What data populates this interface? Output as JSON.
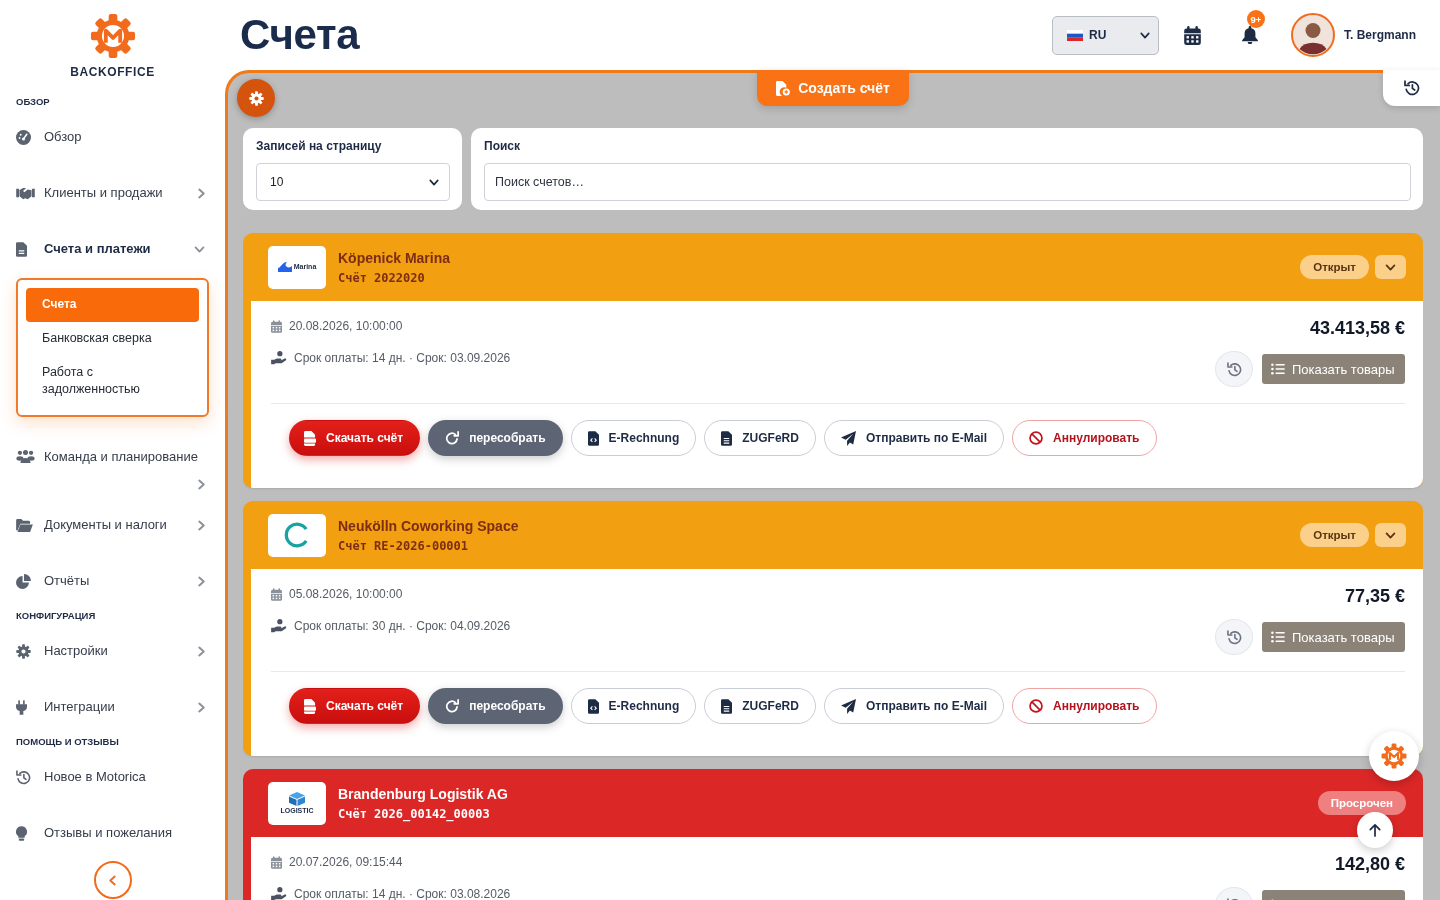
{
  "sidebar": {
    "logo_text": "BACKOFFICE",
    "sections": [
      {
        "title": "ОБЗОР",
        "items": [
          {
            "label": "Обзор"
          },
          {
            "label": "Клиенты и продажи",
            "expanded": false
          },
          {
            "label": "Счета и платежи",
            "expanded": true,
            "children": [
              {
                "label": "Счета",
                "selected": true
              },
              {
                "label": "Банковская сверка",
                "selected": false
              },
              {
                "label": "Работа с задолженностью",
                "selected": false
              }
            ]
          },
          {
            "label": "Команда и планирование",
            "expanded": false
          },
          {
            "label": "Документы и налоги",
            "expanded": false
          },
          {
            "label": "Отчёты",
            "expanded": false
          }
        ]
      },
      {
        "title": "КОНФИГУРАЦИЯ",
        "items": [
          {
            "label": "Настройки",
            "expanded": false
          },
          {
            "label": "Интеграции",
            "expanded": false
          }
        ]
      },
      {
        "title": "ПОМОЩЬ И ОТЗЫВЫ",
        "items": [
          {
            "label": "Новое в Motorica"
          },
          {
            "label": "Отзывы и пожелания"
          }
        ]
      }
    ]
  },
  "header": {
    "title": "Счета",
    "language": "RU",
    "notification_count": "9+",
    "user_name": "T. Bergmann"
  },
  "toolbar": {
    "create_button": "Создать счёт"
  },
  "filters": {
    "per_page": {
      "label": "Записей на страницу",
      "value": "10"
    },
    "search": {
      "label": "Поиск",
      "placeholder": "Поиск счетов…"
    }
  },
  "invoices": [
    {
      "company": "Köpenick Marina",
      "logo_text": "Marina",
      "number": "Счёт 2022020",
      "status": {
        "label": "Открыт",
        "kind": "open"
      },
      "expand_toggle": true,
      "date": "20.08.2026, 10:00:00",
      "terms": "Срок оплаты: 14 дн. · Срок: 03.09.2026",
      "amount": "43.413,58 €",
      "items_button": "Показать товары",
      "actions": [
        {
          "label": "Скачать счёт",
          "kind": "primary"
        },
        {
          "label": "пересобрать",
          "kind": "secondary"
        },
        {
          "label": "E-Rechnung",
          "kind": "outline"
        },
        {
          "label": "ZUGFeRD",
          "kind": "outline"
        },
        {
          "label": "Отправить по E-Mail",
          "kind": "outline"
        },
        {
          "label": "Аннулировать",
          "kind": "danger"
        }
      ]
    },
    {
      "company": "Neukölln Coworking Space",
      "number": "Счёт RE-2026-00001",
      "status": {
        "label": "Открыт",
        "kind": "open"
      },
      "expand_toggle": true,
      "date": "05.08.2026, 10:00:00",
      "terms": "Срок оплаты: 30 дн. · Срок: 04.09.2026",
      "amount": "77,35 €",
      "items_button": "Показать товары",
      "actions": [
        {
          "label": "Скачать счёт",
          "kind": "primary"
        },
        {
          "label": "пересобрать",
          "kind": "secondary"
        },
        {
          "label": "E-Rechnung",
          "kind": "outline"
        },
        {
          "label": "ZUGFeRD",
          "kind": "outline"
        },
        {
          "label": "Отправить по E-Mail",
          "kind": "outline"
        },
        {
          "label": "Аннулировать",
          "kind": "danger"
        }
      ]
    },
    {
      "company": "Brandenburg Logistik AG",
      "logo_text": "LOGISTIC",
      "number": "Счёт 2026_00142_00003",
      "status": {
        "label": "Просрочен",
        "kind": "overdue"
      },
      "expand_toggle": false,
      "date": "20.07.2026, 09:15:44",
      "terms": "Срок оплаты: 14 дн. · Срок: 03.08.2026",
      "amount": "142,80 €"
    }
  ]
}
